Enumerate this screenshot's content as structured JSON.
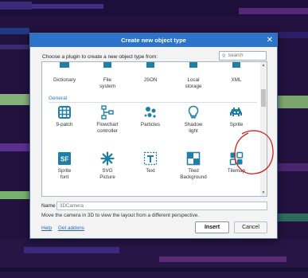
{
  "dialog": {
    "title": "Create new object type",
    "close_glyph": "✕",
    "prompt": "Choose a plugin to create a new object type from:",
    "search_placeholder": "Search"
  },
  "plugins": {
    "row0": [
      {
        "label": "Dictionary",
        "icon": "dictionary-icon"
      },
      {
        "label": "File\nsystem",
        "icon": "file-system-icon"
      },
      {
        "label": "JSON",
        "icon": "json-icon"
      },
      {
        "label": "Local\nstorage",
        "icon": "local-storage-icon"
      },
      {
        "label": "XML",
        "icon": "xml-icon"
      }
    ],
    "section_title": "General",
    "row1": [
      {
        "label": "9-patch",
        "icon": "nine-patch-icon"
      },
      {
        "label": "Flowchart\ncontroller",
        "icon": "flowchart-icon"
      },
      {
        "label": "Particles",
        "icon": "particles-icon"
      },
      {
        "label": "Shadow\nlight",
        "icon": "shadow-light-icon"
      },
      {
        "label": "Sprite",
        "icon": "sprite-icon"
      }
    ],
    "row2": [
      {
        "label": "Sprite\nfont",
        "icon": "sprite-font-icon"
      },
      {
        "label": "SVG\nPicture",
        "icon": "svg-picture-icon"
      },
      {
        "label": "Text",
        "icon": "text-icon"
      },
      {
        "label": "Tiled\nBackground",
        "icon": "tiled-background-icon"
      },
      {
        "label": "Tilemap",
        "icon": "tilemap-icon"
      }
    ]
  },
  "name_field": {
    "label": "Name",
    "placeholder": "3DCamera"
  },
  "description": "Move the camera in 3D to view the layout from a different perspective.",
  "links": {
    "help": "Help",
    "addons": "Get addons"
  },
  "buttons": {
    "insert": "Insert",
    "cancel": "Cancel"
  },
  "colors": {
    "accent": "#2a75c9",
    "icon": "#1f7fa6",
    "annotation": "#d42020"
  }
}
